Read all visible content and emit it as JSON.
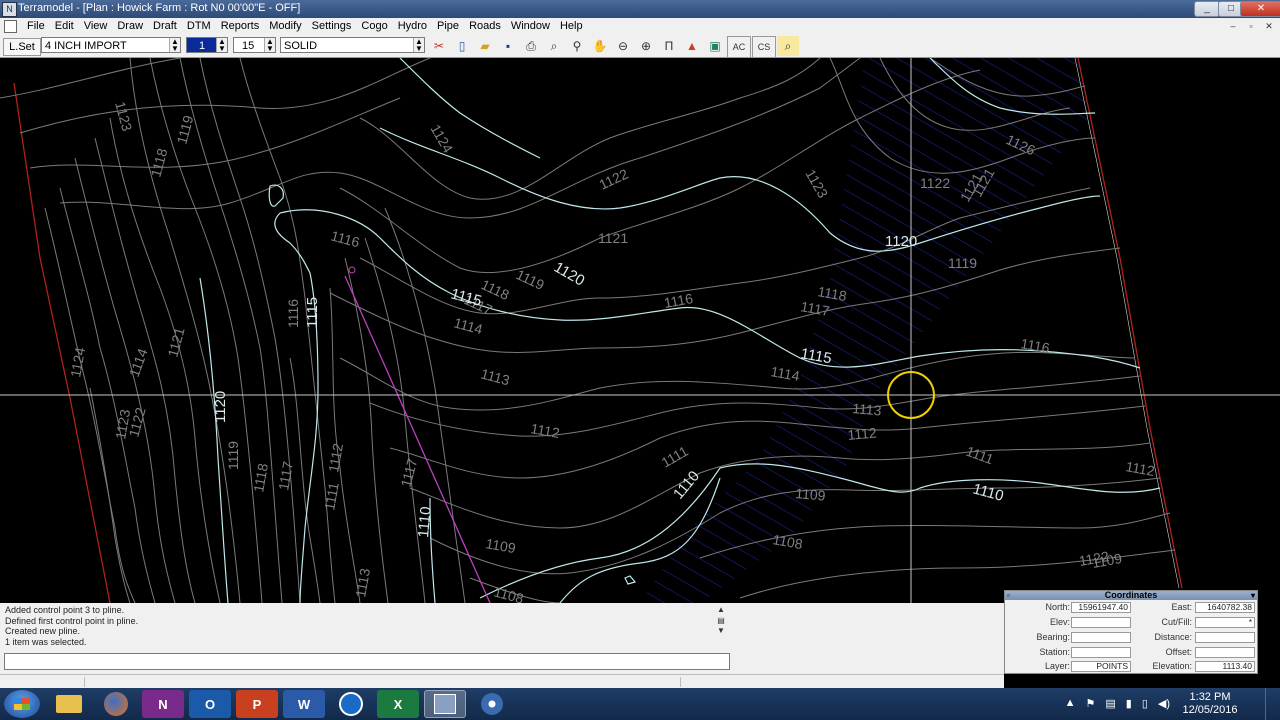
{
  "window": {
    "title": "Terramodel - [Plan : Howick Farm : Rot N0 00'00\"E - OFF]",
    "buttons": [
      "_",
      "□",
      "✕"
    ]
  },
  "menu": {
    "items": [
      "File",
      "Edit",
      "View",
      "Draw",
      "Draft",
      "DTM",
      "Reports",
      "Modify",
      "Settings",
      "Cogo",
      "Hydro",
      "Pipe",
      "Roads",
      "Window",
      "Help"
    ]
  },
  "toolbar": {
    "lset_label": "L.Set",
    "layer": "4 INCH IMPORT",
    "color": "1",
    "width": "15",
    "linetype": "SOLID"
  },
  "drawing": {
    "contour_labels": [
      {
        "text": "1124",
        "major": false
      },
      {
        "text": "1123",
        "major": false
      },
      {
        "text": "1121",
        "major": false
      },
      {
        "text": "1122",
        "major": false
      },
      {
        "text": "1123",
        "major": false
      },
      {
        "text": "1126",
        "major": false
      },
      {
        "text": "1116",
        "major": false
      },
      {
        "text": "1119",
        "major": false
      },
      {
        "text": "1120",
        "major": true
      },
      {
        "text": "1118",
        "major": false
      },
      {
        "text": "1117",
        "major": false
      },
      {
        "text": "1122",
        "major": false
      },
      {
        "text": "1121",
        "major": false
      },
      {
        "text": "1120",
        "major": true
      },
      {
        "text": "1119",
        "major": false
      },
      {
        "text": "1115",
        "major": true
      },
      {
        "text": "1114",
        "major": false
      },
      {
        "text": "1116",
        "major": false
      },
      {
        "text": "1118",
        "major": false
      },
      {
        "text": "1117",
        "major": false
      },
      {
        "text": "1115",
        "major": true
      },
      {
        "text": "1116",
        "major": false
      },
      {
        "text": "1113",
        "major": false
      },
      {
        "text": "1114",
        "major": false
      },
      {
        "text": "1113",
        "major": false
      },
      {
        "text": "1112",
        "major": false
      },
      {
        "text": "1112",
        "major": false
      },
      {
        "text": "1111",
        "major": false
      },
      {
        "text": "1111",
        "major": false
      },
      {
        "text": "1112",
        "major": false
      },
      {
        "text": "1110",
        "major": true
      },
      {
        "text": "1110",
        "major": true
      },
      {
        "text": "1109",
        "major": false
      },
      {
        "text": "1108",
        "major": false
      },
      {
        "text": "1109",
        "major": false
      },
      {
        "text": "1109",
        "major": false
      },
      {
        "text": "1108",
        "major": false
      },
      {
        "text": "1110",
        "major": true
      },
      {
        "text": "1120",
        "major": true
      },
      {
        "text": "1119",
        "major": false
      },
      {
        "text": "1118",
        "major": false
      },
      {
        "text": "1117",
        "major": false
      },
      {
        "text": "1116",
        "major": false
      },
      {
        "text": "1115",
        "major": true
      },
      {
        "text": "1122",
        "major": false
      },
      {
        "text": "1121",
        "major": false
      },
      {
        "text": "1124",
        "major": false
      },
      {
        "text": "1123",
        "major": false
      },
      {
        "text": "1118",
        "major": false
      },
      {
        "text": "1119",
        "major": false
      },
      {
        "text": "1114",
        "major": false
      },
      {
        "text": "1113",
        "major": false
      },
      {
        "text": "1112",
        "major": false
      },
      {
        "text": "1111",
        "major": false
      },
      {
        "text": "1121",
        "major": false
      },
      {
        "text": "1122",
        "major": false
      },
      {
        "text": "1117",
        "major": false
      }
    ]
  },
  "command": {
    "log": [
      "Added control point 3 to pline.",
      "Defined first control point in pline.",
      "Created new pline.",
      "1 item was selected."
    ],
    "input_value": ""
  },
  "coordinates": {
    "title": "Coordinates",
    "north_label": "North:",
    "north": "15961947.40",
    "east_label": "East:",
    "east": "1640782.38",
    "elev_label": "Elev:",
    "elev": "",
    "cutfill_label": "Cut/Fill:",
    "cutfill": "*",
    "bearing_label": "Bearing:",
    "bearing": "",
    "distance_label": "Distance:",
    "distance": "",
    "station_label": "Station:",
    "station": "",
    "offset_label": "Offset:",
    "offset": "",
    "layer_label": "Layer:",
    "layer": "POINTS",
    "elevation_label": "Elevation:",
    "elevation": "1113.40"
  },
  "taskbar": {
    "apps": [
      {
        "name": "file-explorer",
        "glyph": ""
      },
      {
        "name": "firefox",
        "glyph": ""
      },
      {
        "name": "onenote",
        "glyph": "N"
      },
      {
        "name": "outlook",
        "glyph": "O"
      },
      {
        "name": "powerpoint",
        "glyph": "P"
      },
      {
        "name": "word",
        "glyph": "W"
      },
      {
        "name": "teamviewer",
        "glyph": ""
      },
      {
        "name": "excel",
        "glyph": "X"
      },
      {
        "name": "terramodel",
        "glyph": ""
      },
      {
        "name": "app-circle",
        "glyph": ""
      }
    ],
    "time": "1:32 PM",
    "date": "12/05/2016"
  },
  "colors": {
    "background": "#000000",
    "minor_contour": "#808080",
    "major_contour": "#bfe8ea",
    "boundary": "#b0221a",
    "pline": "#c040c0",
    "hatch": "#1a1f8a",
    "cursor_circle": "#f0d000",
    "crosshair": "#c8c8c8"
  }
}
